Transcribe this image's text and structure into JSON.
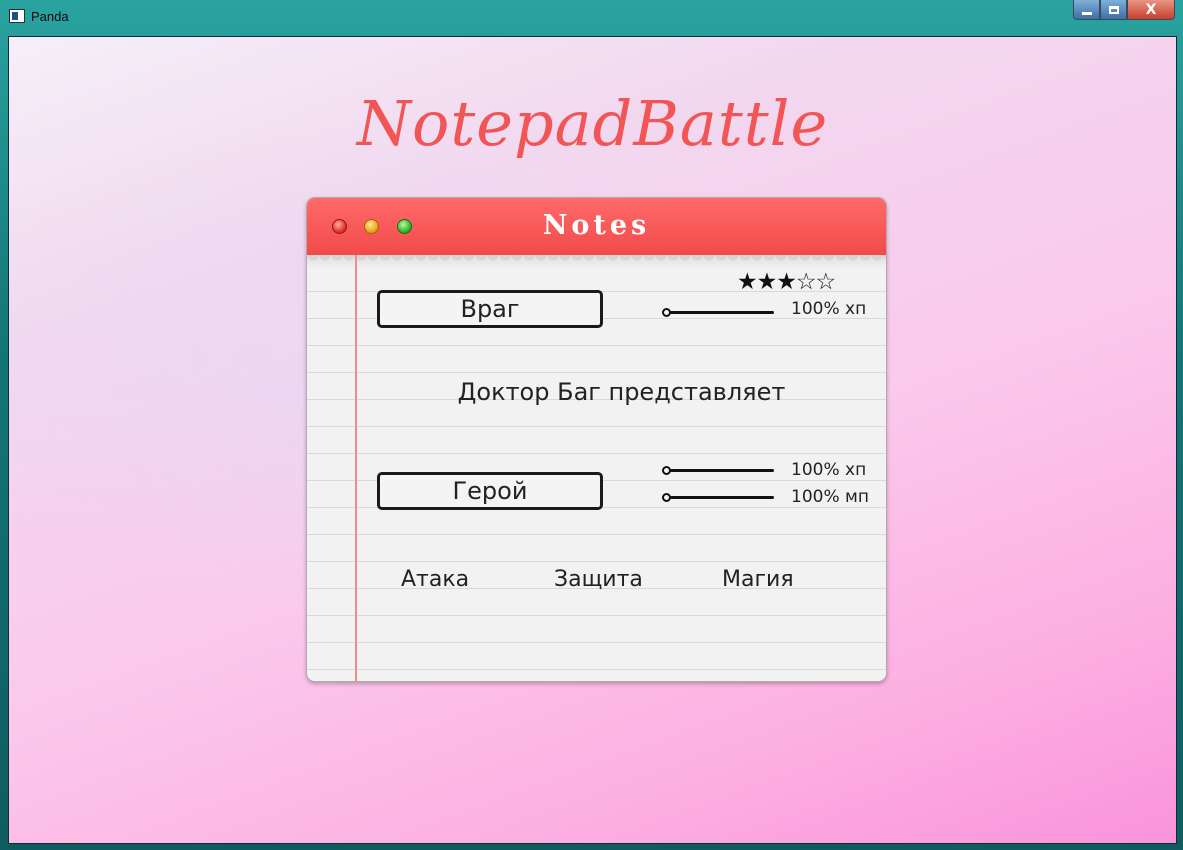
{
  "window": {
    "title": "Panda",
    "controls": {
      "minimize": "",
      "maximize": "",
      "close": "X"
    }
  },
  "game": {
    "title": "NotepadBattle"
  },
  "notepad": {
    "title": "Notes",
    "difficulty_stars": {
      "filled": 3,
      "total": 5,
      "filled_glyph": "★",
      "empty_glyph": "☆"
    },
    "enemy": {
      "label": "Враг",
      "hp_fraction": 1.0,
      "hp_text": "100% хп"
    },
    "message": "Доктор Баг представляет",
    "hero": {
      "label": "Герой",
      "hp_fraction": 1.0,
      "hp_text": "100% хп",
      "mp_fraction": 1.0,
      "mp_text": "100% мп"
    },
    "actions": [
      "Атака",
      "Защита",
      "Магия"
    ]
  },
  "colors": {
    "title_red": "#f25555",
    "header_red": "#f24a4a",
    "margin_line": "#f28c8c"
  }
}
